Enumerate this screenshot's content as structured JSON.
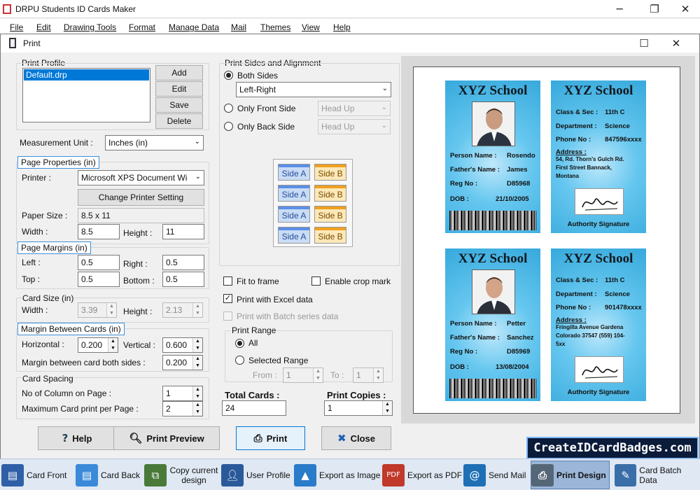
{
  "app": {
    "title": "DRPU Students ID Cards Maker"
  },
  "menu": [
    "File",
    "Edit",
    "Drawing Tools",
    "Format",
    "Manage Data",
    "Mail",
    "Themes",
    "View",
    "Help"
  ],
  "dialog": {
    "title": "Print"
  },
  "print_profile": {
    "legend": "Print Profile",
    "items": [
      "Default.drp"
    ],
    "add": "Add",
    "edit": "Edit",
    "save": "Save",
    "delete": "Delete"
  },
  "measurement": {
    "label": "Measurement Unit :",
    "value": "Inches (in)"
  },
  "page_properties": {
    "legend": "Page Properties (in)",
    "printer_label": "Printer :",
    "printer_value": "Microsoft XPS Document Wi",
    "change_printer": "Change Printer Setting",
    "paper_size_label": "Paper Size :",
    "paper_size_value": "8.5 x 11",
    "width_label": "Width :",
    "width_value": "8.5",
    "height_label": "Height :",
    "height_value": "11"
  },
  "page_margins": {
    "legend": "Page Margins (in)",
    "left_label": "Left :",
    "left_value": "0.5",
    "right_label": "Right :",
    "right_value": "0.5",
    "top_label": "Top :",
    "top_value": "0.5",
    "bottom_label": "Bottom :",
    "bottom_value": "0.5"
  },
  "card_size": {
    "legend": "Card Size (in)",
    "width_label": "Width :",
    "width_value": "3.39",
    "height_label": "Height :",
    "height_value": "2.13"
  },
  "margin_between": {
    "legend": "Margin Between Cards (in)",
    "horizontal_label": "Horizontal :",
    "horizontal_value": "0.200",
    "vertical_label": "Vertical :",
    "vertical_value": "0.600",
    "both_label": "Margin between card both sides :",
    "both_value": "0.200"
  },
  "card_spacing": {
    "legend": "Card Spacing",
    "columns_label": "No of Column on Page :",
    "columns_value": "1",
    "max_label": "Maximum Card print per Page :",
    "max_value": "2"
  },
  "sides": {
    "legend": "Print Sides and Alignment",
    "both": "Both Sides",
    "both_value": "Left-Right",
    "front": "Only Front Side",
    "front_value": "Head Up",
    "back": "Only Back Side",
    "back_value": "Head Up",
    "tiles": [
      [
        "Side A",
        "Side B"
      ],
      [
        "Side A",
        "Side B"
      ],
      [
        "Side A",
        "Side B"
      ],
      [
        "Side A",
        "Side B"
      ]
    ]
  },
  "options": {
    "fit": "Fit to frame",
    "crop": "Enable crop mark",
    "excel": "Print with Excel data",
    "batch": "Print with Batch series data"
  },
  "range": {
    "legend": "Print Range",
    "all": "All",
    "selected": "Selected Range",
    "from_label": "From :",
    "from_value": "1",
    "to_label": "To :",
    "to_value": "1"
  },
  "totals": {
    "cards_label": "Total Cards :",
    "cards_value": "24",
    "copies_label": "Print Copies :",
    "copies_value": "1"
  },
  "preview": {
    "cards": [
      {
        "school": "XYZ School",
        "name_label": "Person Name :",
        "name": "Rosendo",
        "father_label": "Father's Name :",
        "father": "James",
        "reg_label": "Reg No :",
        "reg": "D85968",
        "dob_label": "DOB :",
        "dob": "21/10/2005"
      },
      {
        "school": "XYZ School",
        "name_label": "Person Name :",
        "name": "Petter",
        "father_label": "Father's Name :",
        "father": "Sanchez",
        "reg_label": "Reg No :",
        "reg": "D85969",
        "dob_label": "DOB :",
        "dob": "13/08/2004"
      }
    ],
    "backs": [
      {
        "school": "XYZ School",
        "class_label": "Class & Sec :",
        "class": "11th C",
        "dept_label": "Department :",
        "dept": "Science",
        "phone_label": "Phone No :",
        "phone": "847596xxxx",
        "addr_label": "Address :",
        "addr1": "54, Rd. Thorn's Gulch Rd.",
        "addr2": "First Street Bannack,",
        "addr3": "Montana",
        "sig": "Authority Signature"
      },
      {
        "school": "XYZ School",
        "class_label": "Class & Sec :",
        "class": "11th C",
        "dept_label": "Department :",
        "dept": "Science",
        "phone_label": "Phone No :",
        "phone": "901478xxxx",
        "addr_label": "Address :",
        "addr1": "Fringilla Avenue Gardena",
        "addr2": "Colorado 37547 (559) 104-",
        "addr3": "5xx",
        "sig": "Authority Signature"
      }
    ]
  },
  "buttons": {
    "help": "Help",
    "preview": "Print Preview",
    "print": "Print",
    "close": "Close"
  },
  "brand": "CreateIDCardBadges.com",
  "taskbar": [
    {
      "label": "Card Front",
      "icon": "card-front-icon",
      "color": "#2f5fa7"
    },
    {
      "label": "Card Back",
      "icon": "card-back-icon",
      "color": "#3a8ad9"
    },
    {
      "label": "Copy current design",
      "icon": "copy-design-icon",
      "color": "#4a7a3a"
    },
    {
      "label": "User Profile",
      "icon": "user-profile-icon",
      "color": "#2b5a9a"
    },
    {
      "label": "Export as Image",
      "icon": "export-image-icon",
      "color": "#2a7bc8"
    },
    {
      "label": "Export as PDF",
      "icon": "export-pdf-icon",
      "color": "#c0392b"
    },
    {
      "label": "Send Mail",
      "icon": "send-mail-icon",
      "color": "#1f6fb5"
    },
    {
      "label": "Print Design",
      "icon": "print-design-icon",
      "color": "#556677"
    },
    {
      "label": "Card Batch Data",
      "icon": "card-batch-icon",
      "color": "#3a6ea8"
    }
  ]
}
